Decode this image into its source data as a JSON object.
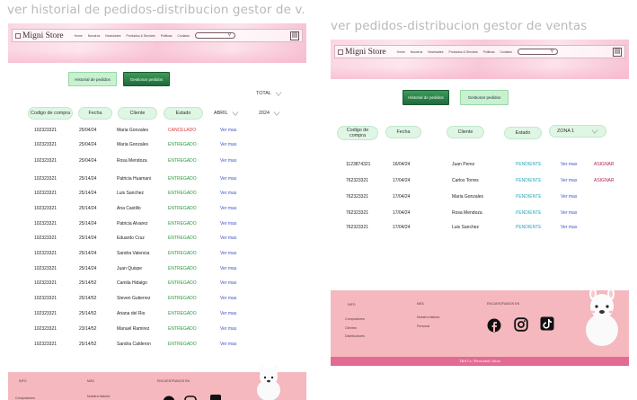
{
  "frames": {
    "left_title": "ver historial de pedidos-distribucion gestor de v...",
    "right_title": "ver pedidos-distribucion gestor de ventas"
  },
  "header": {
    "logo": "Migni Store",
    "nav": [
      "Home",
      "Nosotros",
      "Novedades",
      "Productos & Services",
      "Politicas",
      "Contacto"
    ]
  },
  "left": {
    "buttons": {
      "historial": "Historial de pedidos",
      "gestionar": "Gestionar pedidos"
    },
    "total_label": "TOTAL",
    "filters": {
      "month": "ABRIL",
      "year": "2024"
    },
    "columns": [
      "Codigo de compra",
      "Fecha",
      "Cliente",
      "Estado"
    ],
    "rows": [
      {
        "code": "102323321",
        "date": "25/04/24",
        "client": "Maria Gonzales",
        "status": "CANCELADO",
        "action": "Ver mas"
      },
      {
        "code": "102323321",
        "date": "25/04/24",
        "client": "Maria Gonzales",
        "status": "ENTREGADO",
        "action": "Ver mas"
      },
      {
        "code": "102323321",
        "date": "25/04/24",
        "client": "Rosa Mendoza",
        "status": "ENTREGADO",
        "action": "Ver mas"
      },
      {
        "code": "102323321",
        "date": "25/14/24",
        "client": "Patricia Huamani",
        "status": "ENTREGADO",
        "action": "Ver mas"
      },
      {
        "code": "102323321",
        "date": "25/14/24",
        "client": "Luis Sanchez",
        "status": "ENTREGADO",
        "action": "Ver mas"
      },
      {
        "code": "102323321",
        "date": "25/14/24",
        "client": "Ana Castillo",
        "status": "ENTREGADO",
        "action": "Ver mas"
      },
      {
        "code": "102323321",
        "date": "25/14/24",
        "client": "Patricia Alvarez",
        "status": "ENTREGADO",
        "action": "Ver mas"
      },
      {
        "code": "102323321",
        "date": "25/14/24",
        "client": "Eduardo Cruz",
        "status": "ENTREGADO",
        "action": "Ver mas"
      },
      {
        "code": "102323321",
        "date": "25/14/24",
        "client": "Sandra Valencia",
        "status": "ENTREGADO",
        "action": "Ver mas"
      },
      {
        "code": "102323321",
        "date": "25/14/24",
        "client": "Juan Quispe",
        "status": "ENTREGADO",
        "action": "Ver mas"
      },
      {
        "code": "102323321",
        "date": "25/14/52",
        "client": "Camila Hidalgo",
        "status": "ENTREGADO",
        "action": "Ver mas"
      },
      {
        "code": "102323321",
        "date": "25/14/52",
        "client": "Steven Gutierrez",
        "status": "ENTREGADO",
        "action": "Ver mas"
      },
      {
        "code": "102323321",
        "date": "25/14/52",
        "client": "Ariana del Rio",
        "status": "ENTREGADO",
        "action": "Ver mas"
      },
      {
        "code": "102323321",
        "date": "23/14/52",
        "client": "Manuel Ramirez",
        "status": "ENTREGADO",
        "action": "Ver mas"
      },
      {
        "code": "102323321",
        "date": "25/14/52",
        "client": "Sandra Calderon",
        "status": "ENTREGADO",
        "action": "Ver mas"
      }
    ],
    "footer": {
      "info": "INFO",
      "mas": "MÁS",
      "encuentranos": "ENCUENTRANOS EN",
      "link1": "Compradores",
      "link2": "Nuestra historia"
    }
  },
  "right": {
    "buttons": {
      "historial": "Historial de pedidos",
      "gestionar": "Gestionar pedidos"
    },
    "columns": [
      "Codigo de compra",
      "Fecha",
      "Cliente",
      "Estado"
    ],
    "zone_filter": "ZONA 1",
    "rows": [
      {
        "code": "1123874321",
        "date": "16/04/24",
        "client": "Juan Perez",
        "status": "PENDIENTE",
        "action": "Ver mas",
        "assign": "ASIGNAR"
      },
      {
        "code": "762323321",
        "date": "17/04/24",
        "client": "Carlos Torres",
        "status": "PENDIENTE",
        "action": "Ver mas",
        "assign": "ASIGNAR"
      },
      {
        "code": "762323321",
        "date": "17/04/24",
        "client": "Maria Gonzales",
        "status": "PENDIENTE",
        "action": "Ver mas",
        "assign": ""
      },
      {
        "code": "762323321",
        "date": "17/04/24",
        "client": "Rosa Mendoza",
        "status": "PENDIENTE",
        "action": "Ver mas",
        "assign": ""
      },
      {
        "code": "762323321",
        "date": "17/04/24",
        "client": "Luis Sanchez",
        "status": "PENDIENTE",
        "action": "Ver mas",
        "assign": ""
      }
    ],
    "footer": {
      "info": "INFO",
      "mas": "MÁS",
      "encuentranos": "ENCUENTRANOS EN",
      "links_info": [
        "Compradores",
        "Clientes",
        "Distribuidores"
      ],
      "links_mas": [
        "Nuestra historia",
        "Personal"
      ],
      "bottom": "T&A Co | Privacidad | Inicio"
    }
  },
  "colors": {
    "header_pink": "#f9c8d8",
    "btn_light_green": "#c8f1cf",
    "btn_dark_green": "#2a7e48",
    "status_cancel": "#d23b3b",
    "status_delivered": "#2a9a3c",
    "status_pending": "#2ba5b8",
    "link": "#3a55c8",
    "assign": "#b0245a",
    "footer_pink": "#f4b8be",
    "footer_bottom": "#e26a93"
  },
  "icons": [
    "logo-icon",
    "search-icon",
    "cart-icon",
    "chevron-down-icon",
    "facebook-icon",
    "instagram-icon",
    "tiktok-icon",
    "alpaca-illustration"
  ]
}
